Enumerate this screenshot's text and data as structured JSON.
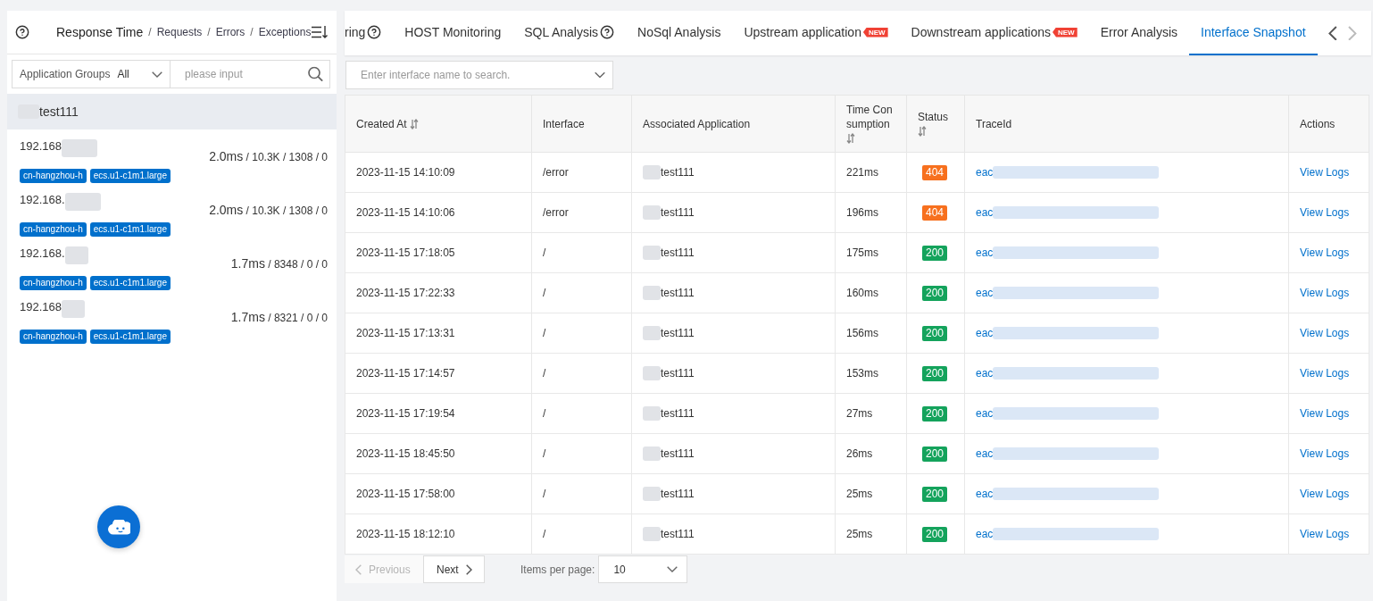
{
  "sidebar": {
    "sort_options": [
      {
        "label": "Response Time",
        "selected": true
      },
      {
        "separator": "/",
        "label": "Requests",
        "selected": false
      },
      {
        "separator": "/",
        "label": "Errors",
        "selected": false
      },
      {
        "separator": "/",
        "label": "Exceptions",
        "selected": false
      }
    ],
    "group_filter": {
      "label": "Application Groups",
      "value": "All"
    },
    "search": {
      "placeholder": "please input"
    },
    "groups": [
      {
        "name": "test111",
        "masked": true,
        "hosts": [
          {
            "ip": "192.168",
            "masked": true,
            "latency": "2.0ms",
            "counts": "/ 10.3K / 1308 / 0",
            "tags": [
              "cn-hangzhou-h",
              "ecs.u1-c1m1.large"
            ]
          },
          {
            "ip": "192.168.",
            "masked": true,
            "latency": "2.0ms",
            "counts": "/ 10.3K / 1308 / 0",
            "tags": [
              "cn-hangzhou-h",
              "ecs.u1-c1m1.large"
            ]
          },
          {
            "ip": "192.168.",
            "masked": true,
            "latency": "1.7ms",
            "counts": "/ 8348 / 0 / 0",
            "tags": [
              "cn-hangzhou-h",
              "ecs.u1-c1m1.large"
            ]
          },
          {
            "ip": "192.168",
            "masked": true,
            "latency": "1.7ms",
            "counts": "/ 8321 / 0 / 0",
            "tags": [
              "cn-hangzhou-h",
              "ecs.u1-c1m1.large"
            ]
          }
        ]
      }
    ]
  },
  "tabs": [
    {
      "label": "ring",
      "help": true,
      "selected": false
    },
    {
      "label": "HOST Monitoring",
      "help": false,
      "selected": false
    },
    {
      "label": "SQL Analysis",
      "help": true,
      "selected": false
    },
    {
      "label": "NoSql Analysis",
      "help": false,
      "selected": false
    },
    {
      "label": "Upstream application",
      "badge": "NEW",
      "help": false,
      "selected": false
    },
    {
      "label": "Downstream applications",
      "badge": "NEW",
      "help": false,
      "selected": false
    },
    {
      "label": "Error Analysis",
      "help": false,
      "selected": false
    },
    {
      "label": "Interface Snapshot",
      "help": false,
      "selected": true
    }
  ],
  "tab_scroll": [
    {
      "kind": "left",
      "disabled": false
    },
    {
      "kind": "right",
      "disabled": true
    }
  ],
  "interface_search": {
    "placeholder": "Enter interface name to search."
  },
  "table": {
    "columns": [
      {
        "label": "Created At",
        "sortable": true
      },
      {
        "label": "Interface",
        "sortable": false
      },
      {
        "label": "Associated Application",
        "sortable": false
      },
      {
        "label": "Time Consumption",
        "sortable": true
      },
      {
        "label": "Status",
        "sortable": true
      },
      {
        "label": "TraceId",
        "sortable": false
      },
      {
        "label": "Actions",
        "sortable": false
      }
    ],
    "rows": [
      {
        "created_at": "2023-11-15 14:10:09",
        "interface": "/error",
        "application": "test111",
        "masked": true,
        "time": "221ms",
        "status": {
          "code": "404",
          "color": "#f7701e"
        },
        "trace_id": "eac",
        "action": "View Logs"
      },
      {
        "created_at": "2023-11-15 14:10:06",
        "interface": "/error",
        "application": "test111",
        "masked": true,
        "time": "196ms",
        "status": {
          "code": "404",
          "color": "#f7701e"
        },
        "trace_id": "eac",
        "action": "View Logs"
      },
      {
        "created_at": "2023-11-15 17:18:05",
        "interface": "/",
        "application": "test111",
        "masked": true,
        "time": "175ms",
        "status": {
          "code": "200",
          "color": "#14a35c"
        },
        "trace_id": "eac",
        "action": "View Logs"
      },
      {
        "created_at": "2023-11-15 17:22:33",
        "interface": "/",
        "application": "test111",
        "masked": true,
        "time": "160ms",
        "status": {
          "code": "200",
          "color": "#14a35c"
        },
        "trace_id": "eac",
        "action": "View Logs"
      },
      {
        "created_at": "2023-11-15 17:13:31",
        "interface": "/",
        "application": "test111",
        "masked": true,
        "time": "156ms",
        "status": {
          "code": "200",
          "color": "#14a35c"
        },
        "trace_id": "eac",
        "action": "View Logs"
      },
      {
        "created_at": "2023-11-15 17:14:57",
        "interface": "/",
        "application": "test111",
        "masked": true,
        "time": "153ms",
        "status": {
          "code": "200",
          "color": "#14a35c"
        },
        "trace_id": "eac",
        "action": "View Logs"
      },
      {
        "created_at": "2023-11-15 17:19:54",
        "interface": "/",
        "application": "test111",
        "masked": true,
        "time": "27ms",
        "status": {
          "code": "200",
          "color": "#14a35c"
        },
        "trace_id": "eac",
        "action": "View Logs"
      },
      {
        "created_at": "2023-11-15 18:45:50",
        "interface": "/",
        "application": "test111",
        "masked": true,
        "time": "26ms",
        "status": {
          "code": "200",
          "color": "#14a35c"
        },
        "trace_id": "eac",
        "action": "View Logs"
      },
      {
        "created_at": "2023-11-15 17:58:00",
        "interface": "/",
        "application": "test111",
        "masked": true,
        "time": "25ms",
        "status": {
          "code": "200",
          "color": "#14a35c"
        },
        "trace_id": "eac",
        "action": "View Logs"
      },
      {
        "created_at": "2023-11-15 18:12:10",
        "interface": "/",
        "application": "test111",
        "masked": true,
        "time": "25ms",
        "status": {
          "code": "200",
          "color": "#14a35c"
        },
        "trace_id": "eac",
        "action": "View Logs"
      }
    ]
  },
  "pagination": {
    "previous": {
      "label": "Previous",
      "disabled": true
    },
    "next": {
      "label": "Next",
      "disabled": false
    },
    "page_size_label": "Items per page:",
    "page_size": "10"
  }
}
